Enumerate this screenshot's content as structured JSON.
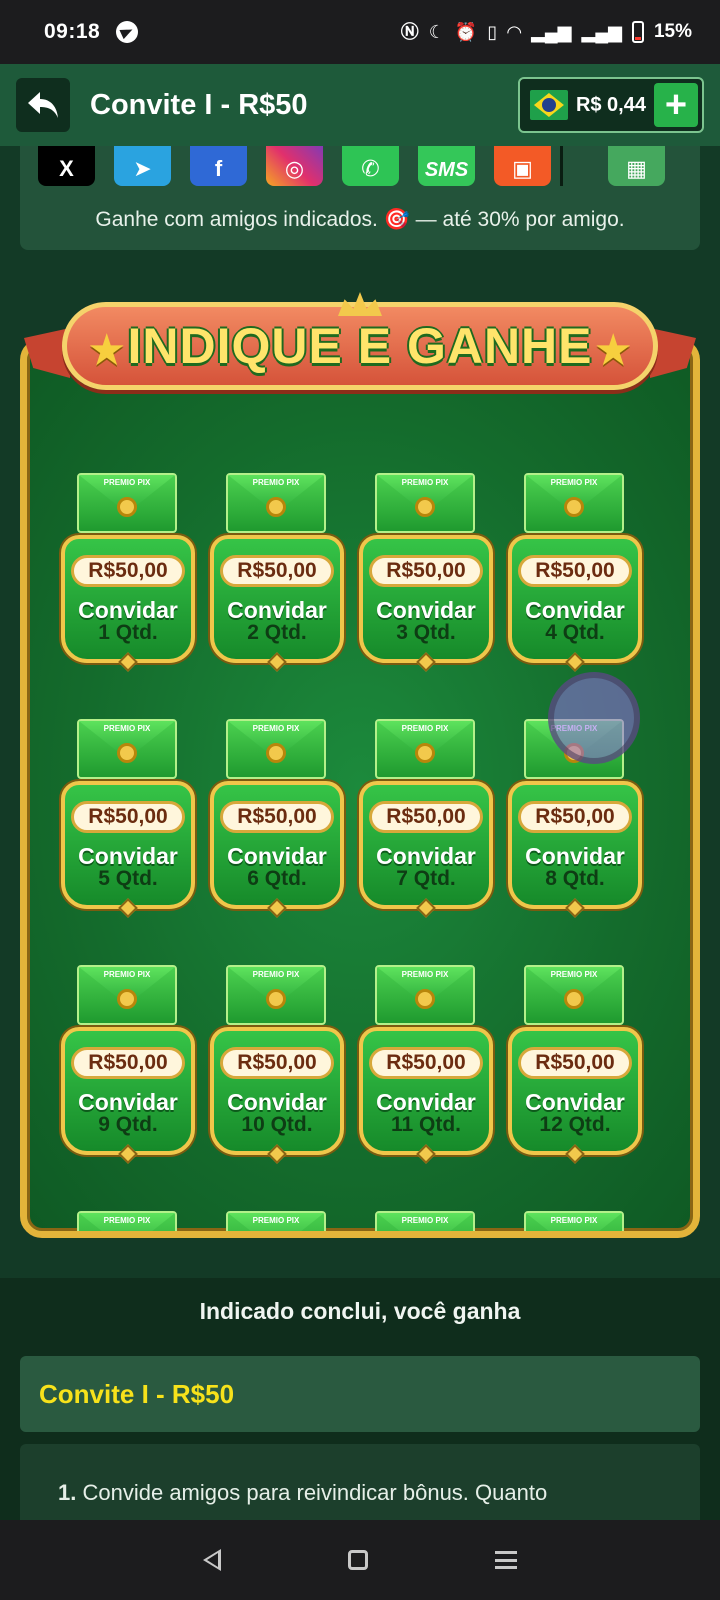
{
  "status_bar": {
    "time": "09:18",
    "battery": "15%",
    "icons": [
      "telegram-icon",
      "nfc-icon",
      "moon-icon",
      "alarm-icon",
      "vibrate-icon",
      "wifi-icon",
      "signal-icon",
      "signal-icon",
      "battery-icon"
    ]
  },
  "header": {
    "title": "Convite I - R$50",
    "balance": "R$ 0,44",
    "plus_label": "+",
    "flag": "brazil-flag-icon"
  },
  "share": {
    "icons": [
      {
        "name": "x-icon",
        "glyph": "X"
      },
      {
        "name": "telegram-icon",
        "glyph": "➤"
      },
      {
        "name": "facebook-icon",
        "glyph": "f"
      },
      {
        "name": "instagram-icon",
        "glyph": "◎"
      },
      {
        "name": "whatsapp-icon",
        "glyph": "✆"
      },
      {
        "name": "sms-icon",
        "glyph": "SMS"
      },
      {
        "name": "kwai-icon",
        "glyph": "▣"
      },
      {
        "name": "more-apps-icon",
        "glyph": "▦"
      }
    ],
    "note": "Ganhe com amigos indicados. 🎯 — até 30% por amigo."
  },
  "promo": {
    "title": "INDIQUE E GANHE",
    "envelope_label": "PREMIO PIX",
    "cards": [
      {
        "price": "R$50,00",
        "action": "Convidar",
        "qty": "1 Qtd."
      },
      {
        "price": "R$50,00",
        "action": "Convidar",
        "qty": "2 Qtd."
      },
      {
        "price": "R$50,00",
        "action": "Convidar",
        "qty": "3 Qtd."
      },
      {
        "price": "R$50,00",
        "action": "Convidar",
        "qty": "4 Qtd."
      },
      {
        "price": "R$50,00",
        "action": "Convidar",
        "qty": "5 Qtd."
      },
      {
        "price": "R$50,00",
        "action": "Convidar",
        "qty": "6 Qtd."
      },
      {
        "price": "R$50,00",
        "action": "Convidar",
        "qty": "7 Qtd."
      },
      {
        "price": "R$50,00",
        "action": "Convidar",
        "qty": "8 Qtd."
      },
      {
        "price": "R$50,00",
        "action": "Convidar",
        "qty": "9 Qtd."
      },
      {
        "price": "R$50,00",
        "action": "Convidar",
        "qty": "10 Qtd."
      },
      {
        "price": "R$50,00",
        "action": "Convidar",
        "qty": "11 Qtd."
      },
      {
        "price": "R$50,00",
        "action": "Convidar",
        "qty": "12 Qtd."
      },
      {
        "price": "",
        "action": "",
        "qty": ""
      },
      {
        "price": "",
        "action": "",
        "qty": ""
      },
      {
        "price": "",
        "action": "",
        "qty": ""
      },
      {
        "price": "",
        "action": "",
        "qty": ""
      }
    ]
  },
  "lower": {
    "title": "Indicado conclui, você ganha",
    "accordion_title": "Convite I - R$50",
    "rule_number": "1.",
    "rule_text": "Convide amigos para reivindicar bônus. Quanto"
  },
  "colors": {
    "accent_yellow": "#f7e21b",
    "brand_green": "#27b24a",
    "header_bg": "#1e5a3a"
  }
}
